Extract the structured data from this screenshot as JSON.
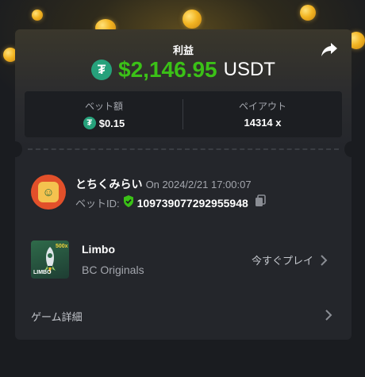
{
  "header": {
    "profit_label": "利益",
    "amount": "$2,146.95",
    "currency": "USDT"
  },
  "stats": {
    "bet_amount_label": "ベット額",
    "bet_amount": "$0.15",
    "payout_label": "ペイアウト",
    "payout": "14314 x"
  },
  "user": {
    "name": "とちくみらい",
    "date": "On 2024/2/21 17:00:07",
    "bet_id_label": "ベットID:",
    "bet_id": "109739077292955948"
  },
  "game": {
    "name": "Limbo",
    "provider": "BC Originals",
    "play_label": "今すぐプレイ",
    "thumb_text": "LIMBO",
    "thumb_badge": "500x"
  },
  "details": {
    "label": "ゲーム詳細"
  },
  "colors": {
    "profit_green": "#3bc117",
    "tether_green": "#26a17b",
    "card_bg": "#24262b",
    "page_bg": "#1a1c20"
  },
  "icons": [
    "share-icon",
    "tether-icon",
    "verified-shield-icon",
    "copy-icon",
    "chevron-right-icon"
  ]
}
